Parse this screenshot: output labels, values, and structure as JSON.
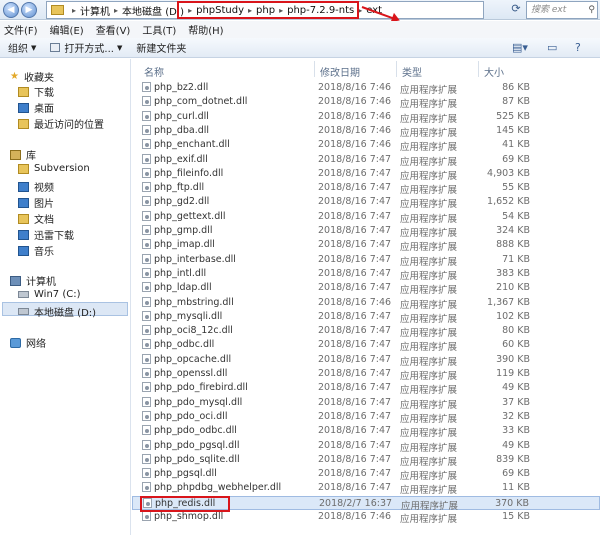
{
  "address": {
    "crumbs": [
      "计算机",
      "本地磁盘 (D:)",
      "phpStudy",
      "php",
      "php-7.2.9-nts",
      "ext"
    ],
    "search_placeholder": "搜索 ext"
  },
  "menu": [
    "文件(F)",
    "编辑(E)",
    "查看(V)",
    "工具(T)",
    "帮助(H)"
  ],
  "toolbar": {
    "organize": "组织",
    "open_with": "打开方式...",
    "new_folder": "新建文件夹"
  },
  "sidebar": {
    "favorites": "收藏夹",
    "fav_items": [
      "下载",
      "桌面",
      "最近访问的位置"
    ],
    "libraries": "库",
    "lib_items": [
      "Subversion",
      "视频",
      "图片",
      "文档",
      "迅雷下载",
      "音乐"
    ],
    "computer": "计算机",
    "drives": [
      "Win7 (C:)",
      "本地磁盘 (D:)"
    ],
    "network": "网络"
  },
  "columns": {
    "name": "名称",
    "date": "修改日期",
    "type": "类型",
    "size": "大小"
  },
  "files": [
    {
      "name": "php_bz2.dll",
      "date": "2018/8/16 7:46",
      "type": "应用程序扩展",
      "size": "86 KB"
    },
    {
      "name": "php_com_dotnet.dll",
      "date": "2018/8/16 7:46",
      "type": "应用程序扩展",
      "size": "87 KB"
    },
    {
      "name": "php_curl.dll",
      "date": "2018/8/16 7:46",
      "type": "应用程序扩展",
      "size": "525 KB"
    },
    {
      "name": "php_dba.dll",
      "date": "2018/8/16 7:46",
      "type": "应用程序扩展",
      "size": "145 KB"
    },
    {
      "name": "php_enchant.dll",
      "date": "2018/8/16 7:46",
      "type": "应用程序扩展",
      "size": "41 KB"
    },
    {
      "name": "php_exif.dll",
      "date": "2018/8/16 7:47",
      "type": "应用程序扩展",
      "size": "69 KB"
    },
    {
      "name": "php_fileinfo.dll",
      "date": "2018/8/16 7:47",
      "type": "应用程序扩展",
      "size": "4,903 KB"
    },
    {
      "name": "php_ftp.dll",
      "date": "2018/8/16 7:47",
      "type": "应用程序扩展",
      "size": "55 KB"
    },
    {
      "name": "php_gd2.dll",
      "date": "2018/8/16 7:47",
      "type": "应用程序扩展",
      "size": "1,652 KB"
    },
    {
      "name": "php_gettext.dll",
      "date": "2018/8/16 7:47",
      "type": "应用程序扩展",
      "size": "54 KB"
    },
    {
      "name": "php_gmp.dll",
      "date": "2018/8/16 7:47",
      "type": "应用程序扩展",
      "size": "324 KB"
    },
    {
      "name": "php_imap.dll",
      "date": "2018/8/16 7:47",
      "type": "应用程序扩展",
      "size": "888 KB"
    },
    {
      "name": "php_interbase.dll",
      "date": "2018/8/16 7:47",
      "type": "应用程序扩展",
      "size": "71 KB"
    },
    {
      "name": "php_intl.dll",
      "date": "2018/8/16 7:47",
      "type": "应用程序扩展",
      "size": "383 KB"
    },
    {
      "name": "php_ldap.dll",
      "date": "2018/8/16 7:47",
      "type": "应用程序扩展",
      "size": "210 KB"
    },
    {
      "name": "php_mbstring.dll",
      "date": "2018/8/16 7:46",
      "type": "应用程序扩展",
      "size": "1,367 KB"
    },
    {
      "name": "php_mysqli.dll",
      "date": "2018/8/16 7:47",
      "type": "应用程序扩展",
      "size": "102 KB"
    },
    {
      "name": "php_oci8_12c.dll",
      "date": "2018/8/16 7:47",
      "type": "应用程序扩展",
      "size": "80 KB"
    },
    {
      "name": "php_odbc.dll",
      "date": "2018/8/16 7:47",
      "type": "应用程序扩展",
      "size": "60 KB"
    },
    {
      "name": "php_opcache.dll",
      "date": "2018/8/16 7:47",
      "type": "应用程序扩展",
      "size": "390 KB"
    },
    {
      "name": "php_openssl.dll",
      "date": "2018/8/16 7:47",
      "type": "应用程序扩展",
      "size": "119 KB"
    },
    {
      "name": "php_pdo_firebird.dll",
      "date": "2018/8/16 7:47",
      "type": "应用程序扩展",
      "size": "49 KB"
    },
    {
      "name": "php_pdo_mysql.dll",
      "date": "2018/8/16 7:47",
      "type": "应用程序扩展",
      "size": "37 KB"
    },
    {
      "name": "php_pdo_oci.dll",
      "date": "2018/8/16 7:47",
      "type": "应用程序扩展",
      "size": "32 KB"
    },
    {
      "name": "php_pdo_odbc.dll",
      "date": "2018/8/16 7:47",
      "type": "应用程序扩展",
      "size": "33 KB"
    },
    {
      "name": "php_pdo_pgsql.dll",
      "date": "2018/8/16 7:47",
      "type": "应用程序扩展",
      "size": "49 KB"
    },
    {
      "name": "php_pdo_sqlite.dll",
      "date": "2018/8/16 7:47",
      "type": "应用程序扩展",
      "size": "839 KB"
    },
    {
      "name": "php_pgsql.dll",
      "date": "2018/8/16 7:47",
      "type": "应用程序扩展",
      "size": "69 KB"
    },
    {
      "name": "php_phpdbg_webhelper.dll",
      "date": "2018/8/16 7:47",
      "type": "应用程序扩展",
      "size": "11 KB"
    },
    {
      "name": "php_redis.dll",
      "date": "2018/2/7 16:37",
      "type": "应用程序扩展",
      "size": "370 KB"
    },
    {
      "name": "php_shmop.dll",
      "date": "2018/8/16 7:46",
      "type": "应用程序扩展",
      "size": "15 KB"
    }
  ],
  "selected_file": "php_redis.dll",
  "colors": {
    "annotation": "#d9151b",
    "selection": "#dbe8f8"
  }
}
